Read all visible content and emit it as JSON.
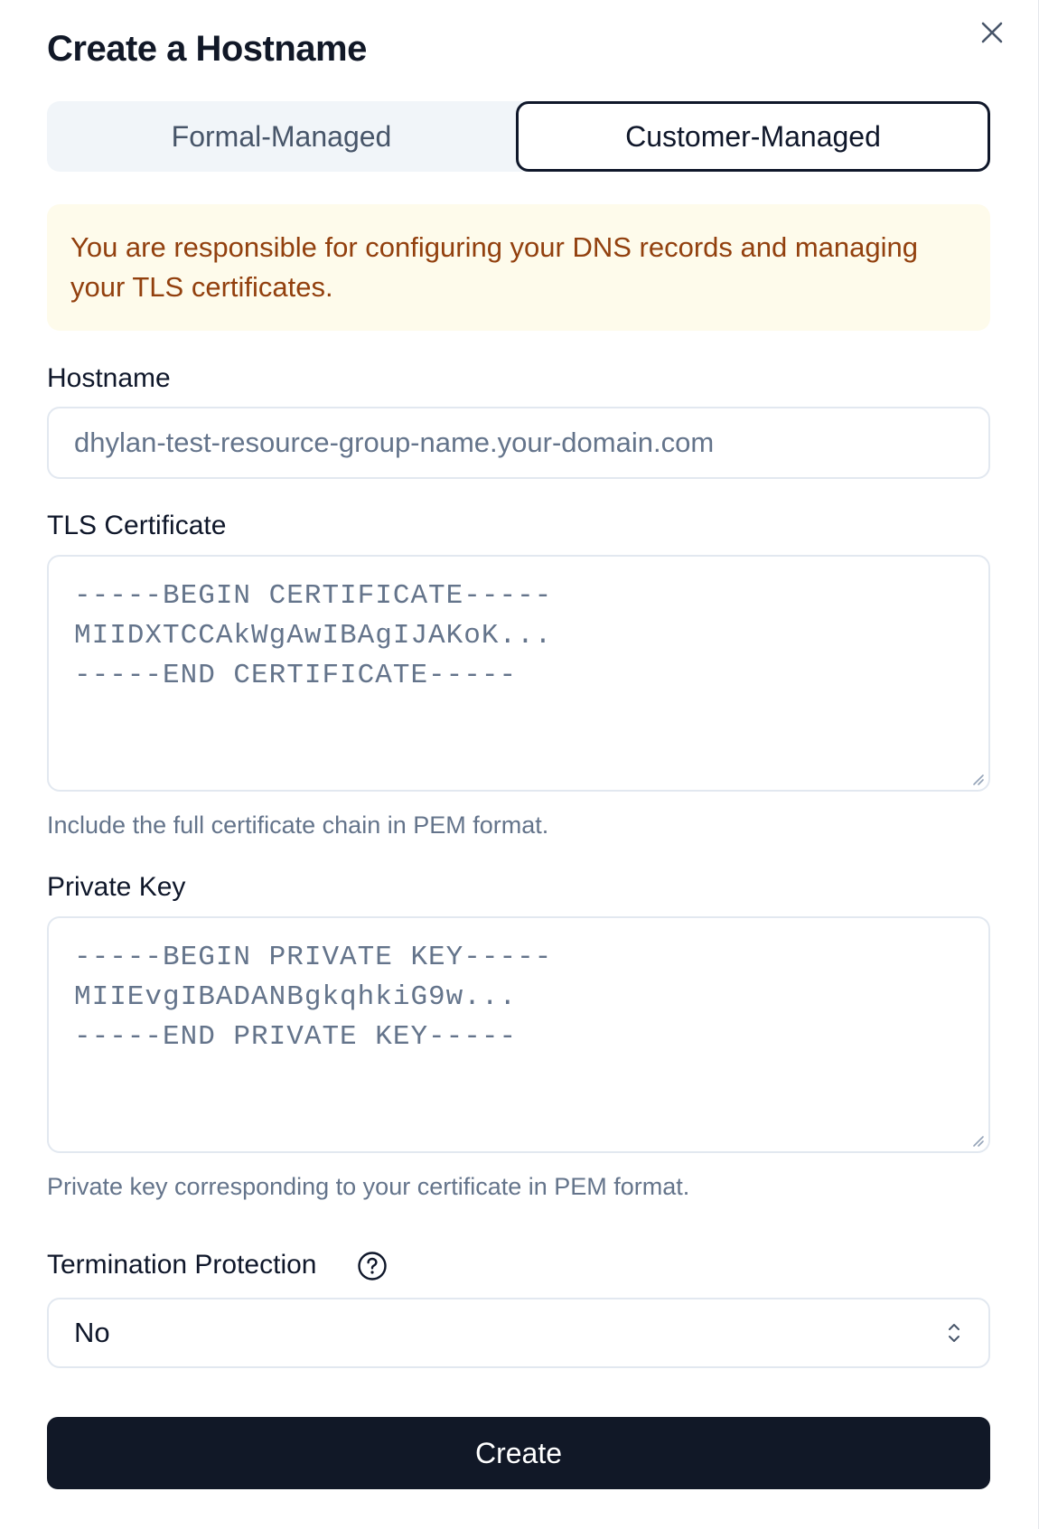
{
  "dialog": {
    "title": "Create a Hostname",
    "close_icon": "close-icon"
  },
  "tabs": [
    {
      "label": "Formal-Managed",
      "active": false
    },
    {
      "label": "Customer-Managed",
      "active": true
    }
  ],
  "alert": {
    "text": "You are responsible for configuring your DNS records and managing your TLS certificates."
  },
  "hostname": {
    "label": "Hostname",
    "placeholder": "dhylan-test-resource-group-name.your-domain.com"
  },
  "tls_certificate": {
    "label": "TLS Certificate",
    "placeholder_lines": [
      "-----BEGIN CERTIFICATE-----",
      "MIIDXTCCAkWgAwIBAgIJAKoK...",
      "-----END CERTIFICATE-----"
    ],
    "help": "Include the full certificate chain in PEM format."
  },
  "private_key": {
    "label": "Private Key",
    "placeholder_lines": [
      "-----BEGIN PRIVATE KEY-----",
      "MIIEvgIBADANBgkqhkiG9w...",
      "-----END PRIVATE KEY-----"
    ],
    "help": "Private key corresponding to your certificate in PEM format."
  },
  "termination_protection": {
    "label": "Termination Protection",
    "help_icon": "question-circle-icon",
    "value": "No",
    "chevron_icon": "chevron-up-down-icon"
  },
  "create_button": {
    "label": "Create"
  },
  "colors": {
    "primary": "#111827",
    "alert_bg": "#fefbeb",
    "alert_text": "#92400e",
    "muted": "#64748b",
    "border": "#e2e8f0"
  }
}
